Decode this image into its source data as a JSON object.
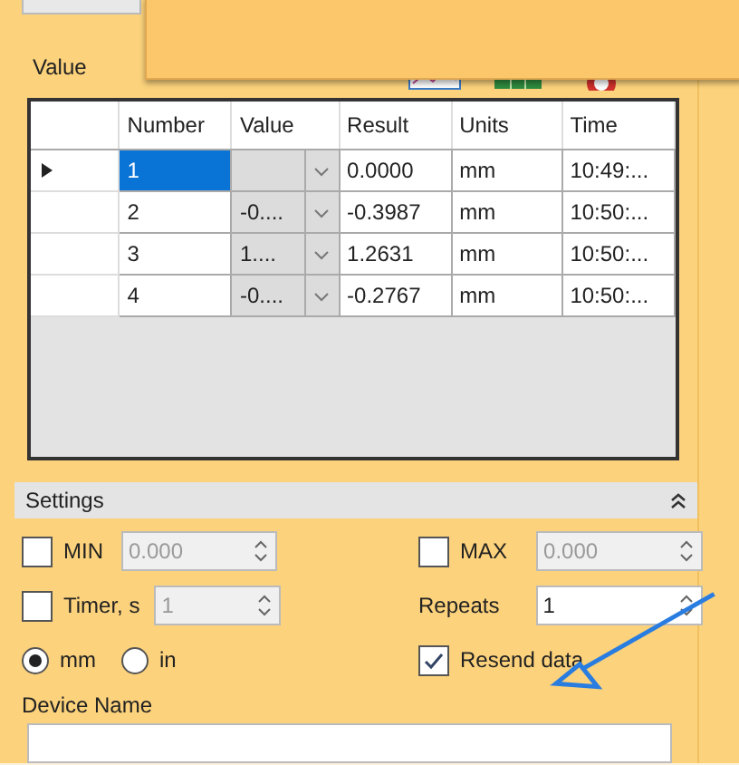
{
  "panel_title": "Value",
  "table": {
    "columns": [
      "Number",
      "Value",
      "Result",
      "Units",
      "Time"
    ],
    "rows": [
      {
        "current": true,
        "selected": true,
        "number": "1",
        "value": "",
        "result": "0.0000",
        "units": "mm",
        "time": "10:49:..."
      },
      {
        "current": false,
        "selected": false,
        "number": "2",
        "value": "-0....",
        "result": "-0.3987",
        "units": "mm",
        "time": "10:50:..."
      },
      {
        "current": false,
        "selected": false,
        "number": "3",
        "value": "1....",
        "result": "1.2631",
        "units": "mm",
        "time": "10:50:..."
      },
      {
        "current": false,
        "selected": false,
        "number": "4",
        "value": "-0....",
        "result": "-0.2767",
        "units": "mm",
        "time": "10:50:..."
      }
    ]
  },
  "settings": {
    "title": "Settings",
    "expanded": true,
    "min": {
      "label": "MIN",
      "checked": false,
      "value": "0.000",
      "disabled": true
    },
    "max": {
      "label": "MAX",
      "checked": false,
      "value": "0.000",
      "disabled": true
    },
    "timer": {
      "label": "Timer, s",
      "checked": false,
      "value": "1",
      "disabled": true
    },
    "repeats": {
      "label": "Repeats",
      "value": "1",
      "disabled": false
    },
    "units": [
      {
        "label": "mm",
        "selected": true
      },
      {
        "label": "in",
        "selected": false
      }
    ],
    "resend": {
      "label": "Resend data",
      "checked": true
    },
    "device_name": {
      "label": "Device Name"
    }
  }
}
